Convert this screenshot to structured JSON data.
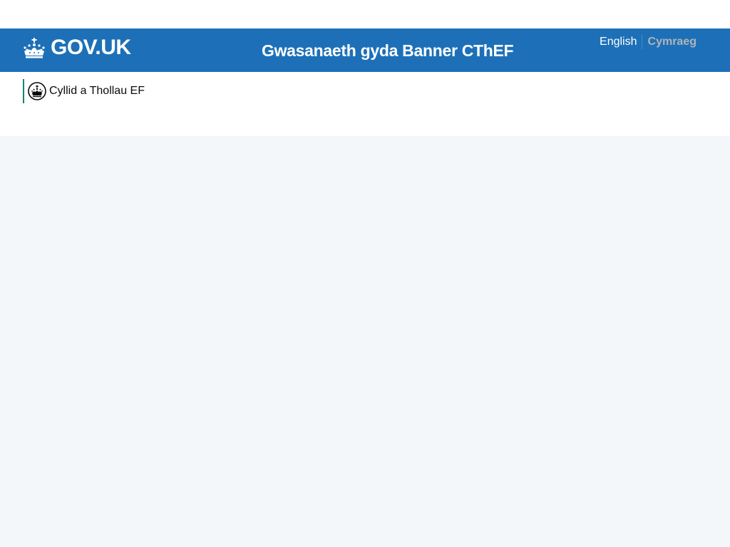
{
  "header": {
    "logo_text": "GOV.UK",
    "service_name": "Gwasanaeth gyda Banner CThEF",
    "background_color": "#1d70b8",
    "logo_icon": "crown-icon"
  },
  "language": {
    "english_label": "English",
    "welsh_label": "Cymraeg",
    "active": "Cymraeg"
  },
  "organisation": {
    "name": "Cyllid a Thollau EF",
    "icon": "crest-icon",
    "accent_color": "#008670"
  },
  "page": {
    "background_color": "#f3f7fa"
  }
}
